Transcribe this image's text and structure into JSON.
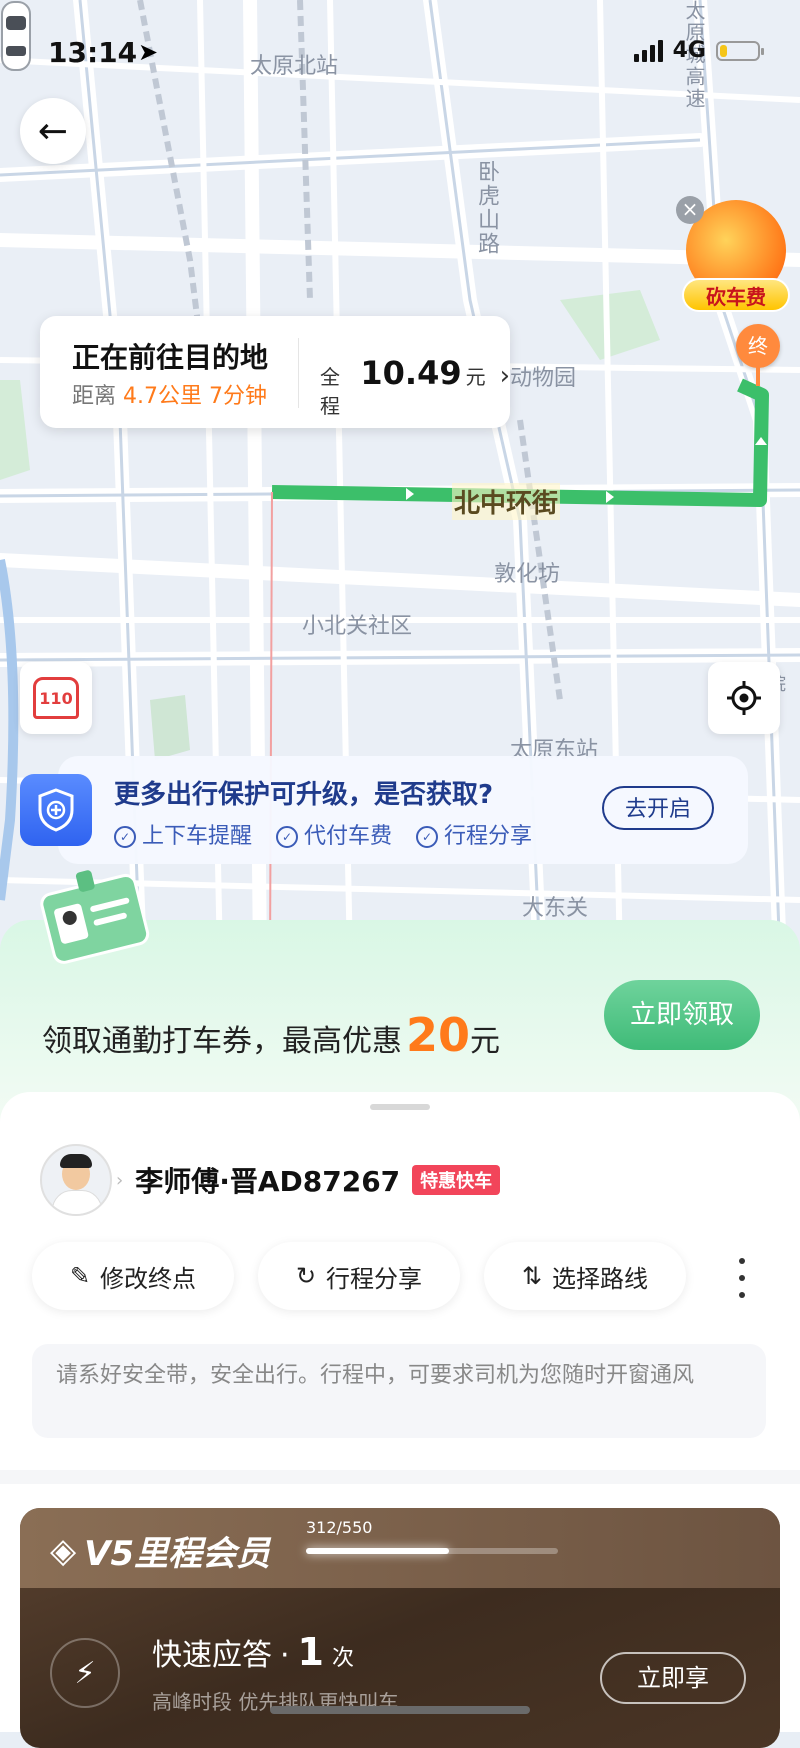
{
  "status_bar": {
    "time": "13:14",
    "network": "4G",
    "battery_level": 0.2
  },
  "map": {
    "labels": {
      "taiyuan_north_station": "太原北站",
      "wohushan_road": "卧虎山路",
      "expressway": "太原城高速",
      "zoo": "动物园",
      "dunhuafang": "敦化坊",
      "xiaobeiguan": "小北关社区",
      "taiyuan_east_station": "太原东站",
      "dadongguan": "大东关",
      "hospital": "医院"
    },
    "road_label": "北中环街",
    "destination_pin": "终"
  },
  "promo_bubble": {
    "label": "砍车费"
  },
  "trip_card": {
    "status": "正在前往目的地",
    "distance_prefix": "距离",
    "distance": "4.7公里",
    "eta": "7分钟",
    "fare_prefix": "全程",
    "fare": "10.49",
    "fare_unit": "元"
  },
  "police_button": {
    "label": "110"
  },
  "protection": {
    "question": "更多出行保护可升级，是否获取?",
    "items": [
      "上下车提醒",
      "代付车费",
      "行程分享"
    ],
    "button": "去开启"
  },
  "coupon": {
    "text": "领取通勤打车券，最高优惠",
    "amount": "20",
    "unit": "元",
    "button": "立即领取"
  },
  "driver": {
    "name": "李师傅·晋AD87267",
    "tag": "特惠快车"
  },
  "actions": {
    "edit_destination": "修改终点",
    "share_trip": "行程分享",
    "choose_route": "选择路线"
  },
  "notice": "请系好安全带，安全出行。行程中，可要求司机为您随时开窗通风",
  "vip": {
    "title": "V5里程会员",
    "progress_text": "312/550",
    "progress": 0.567,
    "perk_title": "快速应答",
    "perk_dot": "·",
    "perk_count": "1",
    "perk_unit": "次",
    "perk_sub": "高峰时段 优先排队更快叫车",
    "button": "立即享"
  },
  "colors": {
    "route": "#3cbf6a",
    "accent_orange": "#ff7a1a",
    "protect_blue": "#1f3b8c",
    "tag_red": "#f2455a"
  }
}
